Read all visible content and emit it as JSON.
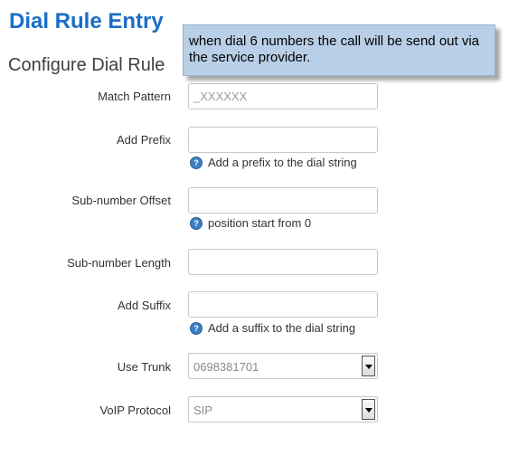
{
  "page": {
    "title": "Dial Rule Entry",
    "section_title": "Configure Dial Rule"
  },
  "tooltip": {
    "text": "when dial 6 numbers the call will be send out via the service provider."
  },
  "form": {
    "match_pattern": {
      "label": "Match Pattern",
      "value": "",
      "placeholder": "_XXXXXX"
    },
    "add_prefix": {
      "label": "Add Prefix",
      "value": "",
      "hint": "Add a prefix to the dial string"
    },
    "sub_number_offset": {
      "label": "Sub-number Offset",
      "value": "",
      "hint": "position start from 0"
    },
    "sub_number_length": {
      "label": "Sub-number Length",
      "value": ""
    },
    "add_suffix": {
      "label": "Add Suffix",
      "value": "",
      "hint": "Add a suffix to the dial string"
    },
    "use_trunk": {
      "label": "Use Trunk",
      "value": "0698381701"
    },
    "voip_protocol": {
      "label": "VoIP Protocol",
      "value": "SIP"
    }
  },
  "colors": {
    "title": "#1a6ec7",
    "tooltip_bg": "#b8cfe7",
    "help_icon": "#3d7fc4"
  },
  "icons": {
    "help": "help-icon",
    "dropdown": "chevron-down-icon"
  }
}
